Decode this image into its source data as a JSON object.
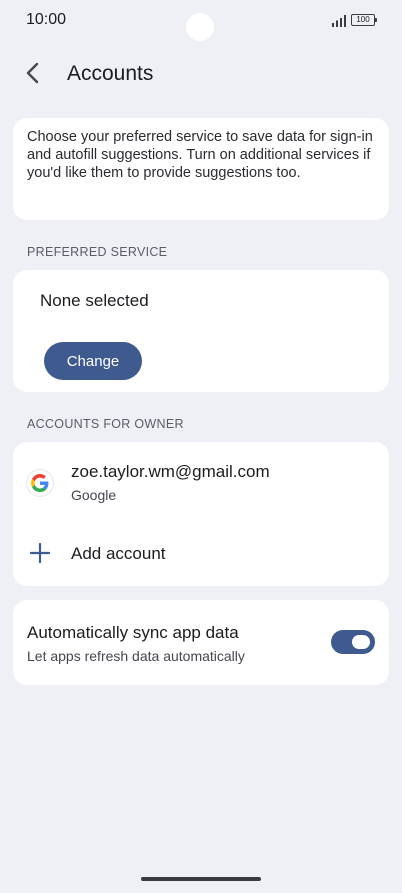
{
  "status_bar": {
    "time": "10:00",
    "battery": "100",
    "signal_icon": "signal-icon"
  },
  "header": {
    "back_icon": "back-arrow-icon",
    "title": "Accounts"
  },
  "info": {
    "text": "Choose your preferred service to save data for sign-in and autofill suggestions. Turn on additional services if you'd like them to provide suggestions too."
  },
  "preferred": {
    "section_label": "PREFERRED SERVICE",
    "value": "None selected",
    "change_label": "Change"
  },
  "accounts": {
    "section_label": "ACCOUNTS FOR OWNER",
    "items": [
      {
        "email": "zoe.taylor.wm@gmail.com",
        "type": "Google",
        "icon": "google-icon"
      }
    ],
    "add_label": "Add account"
  },
  "sync": {
    "title": "Automatically sync app data",
    "subtitle": "Let apps refresh data automatically",
    "enabled": true
  },
  "colors": {
    "accent": "#3f5a8f",
    "background": "#eef0f6",
    "card": "#ffffff"
  }
}
